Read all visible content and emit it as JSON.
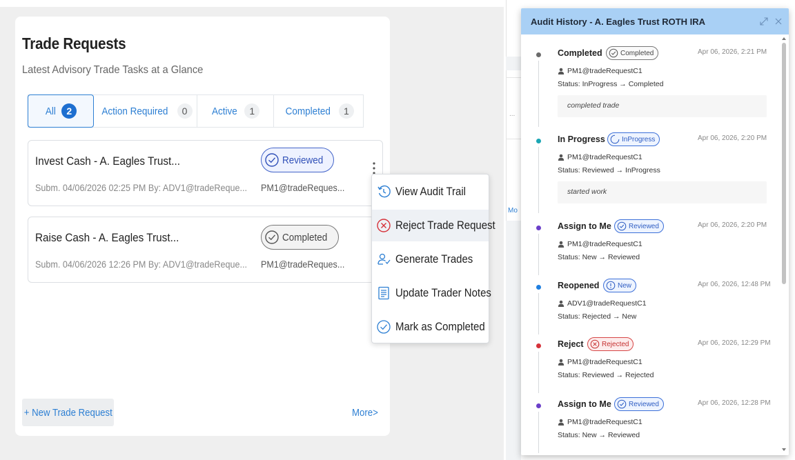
{
  "trade_requests": {
    "title": "Trade Requests",
    "subtitle": "Latest Advisory Trade Tasks at a Glance",
    "tabs": [
      {
        "label": "All",
        "count": "2"
      },
      {
        "label": "Action Required",
        "count": "0"
      },
      {
        "label": "Active",
        "count": "1"
      },
      {
        "label": "Completed",
        "count": "1"
      }
    ],
    "requests": [
      {
        "title": "Invest Cash - A. Eagles Trust...",
        "submitted": "Subm. 04/06/2026 02:25 PM By: ADV1@tradeReque...",
        "status": "Reviewed",
        "assignee": "PM1@tradeReques..."
      },
      {
        "title": "Raise Cash - A. Eagles Trust...",
        "submitted": "Subm. 04/06/2026 12:26 PM By: ADV1@tradeReque...",
        "status": "Completed",
        "assignee": "PM1@tradeReques..."
      }
    ],
    "new_button": "+ New Trade Request",
    "more_link": "More>"
  },
  "context_menu": {
    "items": [
      {
        "label": "View Audit Trail",
        "icon": "history-icon"
      },
      {
        "label": "Reject Trade Request",
        "icon": "x-circle-icon"
      },
      {
        "label": "Generate Trades",
        "icon": "user-check-icon"
      },
      {
        "label": "Update Trader Notes",
        "icon": "notes-icon"
      },
      {
        "label": "Mark as Completed",
        "icon": "check-circle-icon"
      }
    ]
  },
  "background": {
    "ellipsis": "...",
    "more_fragment": "Mo"
  },
  "audit": {
    "title": "Audit History - A. Eagles Trust ROTH IRA",
    "events": [
      {
        "name": "Completed",
        "badge": "Completed",
        "time": "Apr 06, 2026, 2:21 PM",
        "user": "PM1@tradeRequestC1",
        "status": "Status: InProgress → Completed",
        "note": "completed trade",
        "color": "#6b6b6b"
      },
      {
        "name": "In Progress",
        "badge": "InProgress",
        "time": "Apr 06, 2026, 2:20 PM",
        "user": "PM1@tradeRequestC1",
        "status": "Status: Reviewed → InProgress",
        "note": "started work",
        "color": "#1ba6b4"
      },
      {
        "name": "Assign to Me",
        "badge": "Reviewed",
        "time": "Apr 06, 2026, 2:20 PM",
        "user": "PM1@tradeRequestC1",
        "status": "Status: New → Reviewed",
        "note": "",
        "color": "#6b3fc9"
      },
      {
        "name": "Reopened",
        "badge": "New",
        "time": "Apr 06, 2026, 12:48 PM",
        "user": "ADV1@tradeRequestC1",
        "status": "Status: Rejected → New",
        "note": "",
        "color": "#1f7fe0"
      },
      {
        "name": "Reject",
        "badge": "Rejected",
        "time": "Apr 06, 2026, 12:29 PM",
        "user": "PM1@tradeRequestC1",
        "status": "Status: Reviewed → Rejected",
        "note": "",
        "color": "#d6323a"
      },
      {
        "name": "Assign to Me",
        "badge": "Reviewed",
        "time": "Apr 06, 2026, 12:28 PM",
        "user": "PM1@tradeRequestC1",
        "status": "Status: New → Reviewed",
        "note": "",
        "color": "#6b3fc9"
      }
    ]
  }
}
